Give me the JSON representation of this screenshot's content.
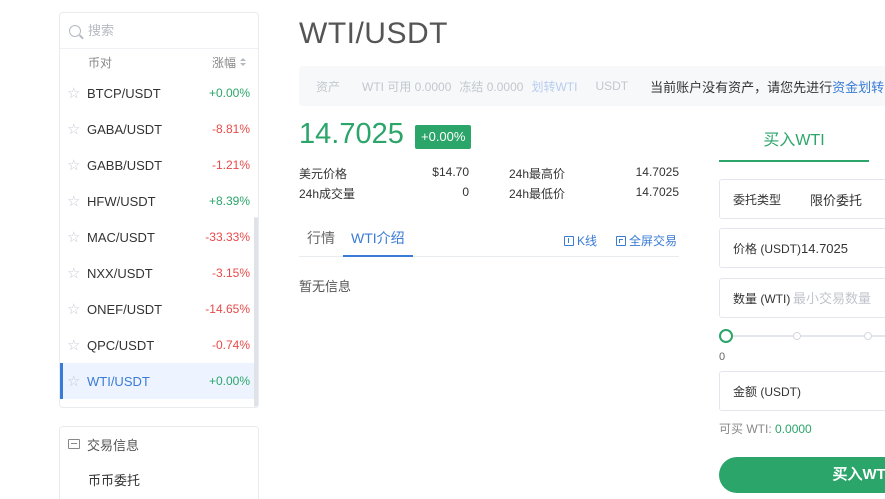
{
  "search": {
    "placeholder": "搜索"
  },
  "market": {
    "col_pair": "币对",
    "col_change": "涨幅",
    "pairs": [
      {
        "name": "BTCP/USDT",
        "change": "+0.00%",
        "dir": "up"
      },
      {
        "name": "GABA/USDT",
        "change": "-8.81%",
        "dir": "down"
      },
      {
        "name": "GABB/USDT",
        "change": "-1.21%",
        "dir": "down"
      },
      {
        "name": "HFW/USDT",
        "change": "+8.39%",
        "dir": "up"
      },
      {
        "name": "MAC/USDT",
        "change": "-33.33%",
        "dir": "down"
      },
      {
        "name": "NXX/USDT",
        "change": "-3.15%",
        "dir": "down"
      },
      {
        "name": "ONEF/USDT",
        "change": "-14.65%",
        "dir": "down"
      },
      {
        "name": "QPC/USDT",
        "change": "-0.74%",
        "dir": "down"
      },
      {
        "name": "WTI/USDT",
        "change": "+0.00%",
        "dir": "up",
        "active": true
      }
    ]
  },
  "trade_info": {
    "title": "交易信息",
    "item": "币币委托"
  },
  "main": {
    "title": "WTI/USDT",
    "asset_bar": {
      "assets_label": "资产",
      "available": "WTI 可用 0.0000",
      "frozen": "冻结 0.0000",
      "transfer": "划转WTI",
      "usdt": "USDT",
      "notice": "当前账户没有资产，请您先进行",
      "notice_link": "资金划转"
    },
    "price": "14.7025",
    "change_badge": "+0.00%",
    "stats": {
      "usd_price_label": "美元价格",
      "usd_price": "$14.70",
      "vol_label": "24h成交量",
      "vol": "0",
      "high_label": "24h最高价",
      "high": "14.7025",
      "low_label": "24h最低价",
      "low": "14.7025"
    },
    "tabs": {
      "market": "行情",
      "intro": "WTI介绍",
      "kline": "K线",
      "fullscreen": "全屏交易"
    },
    "no_info": "暂无信息"
  },
  "order": {
    "tab": "买入WTI",
    "type_label": "委托类型",
    "type_value": "限价委托",
    "price_label": "价格 (USDT)",
    "price_value": "14.7025",
    "qty_label": "数量 (WTI)",
    "qty_placeholder": "最小交易数量",
    "slider_zero": "0",
    "amount_label": "金额 (USDT)",
    "available_label": "可买 WTI:",
    "available_value": "0.0000",
    "buy_button": "买入WTI"
  },
  "colors": {
    "up": "#2ba56a",
    "down": "#e74a4a",
    "accent": "#3a7bd5"
  }
}
